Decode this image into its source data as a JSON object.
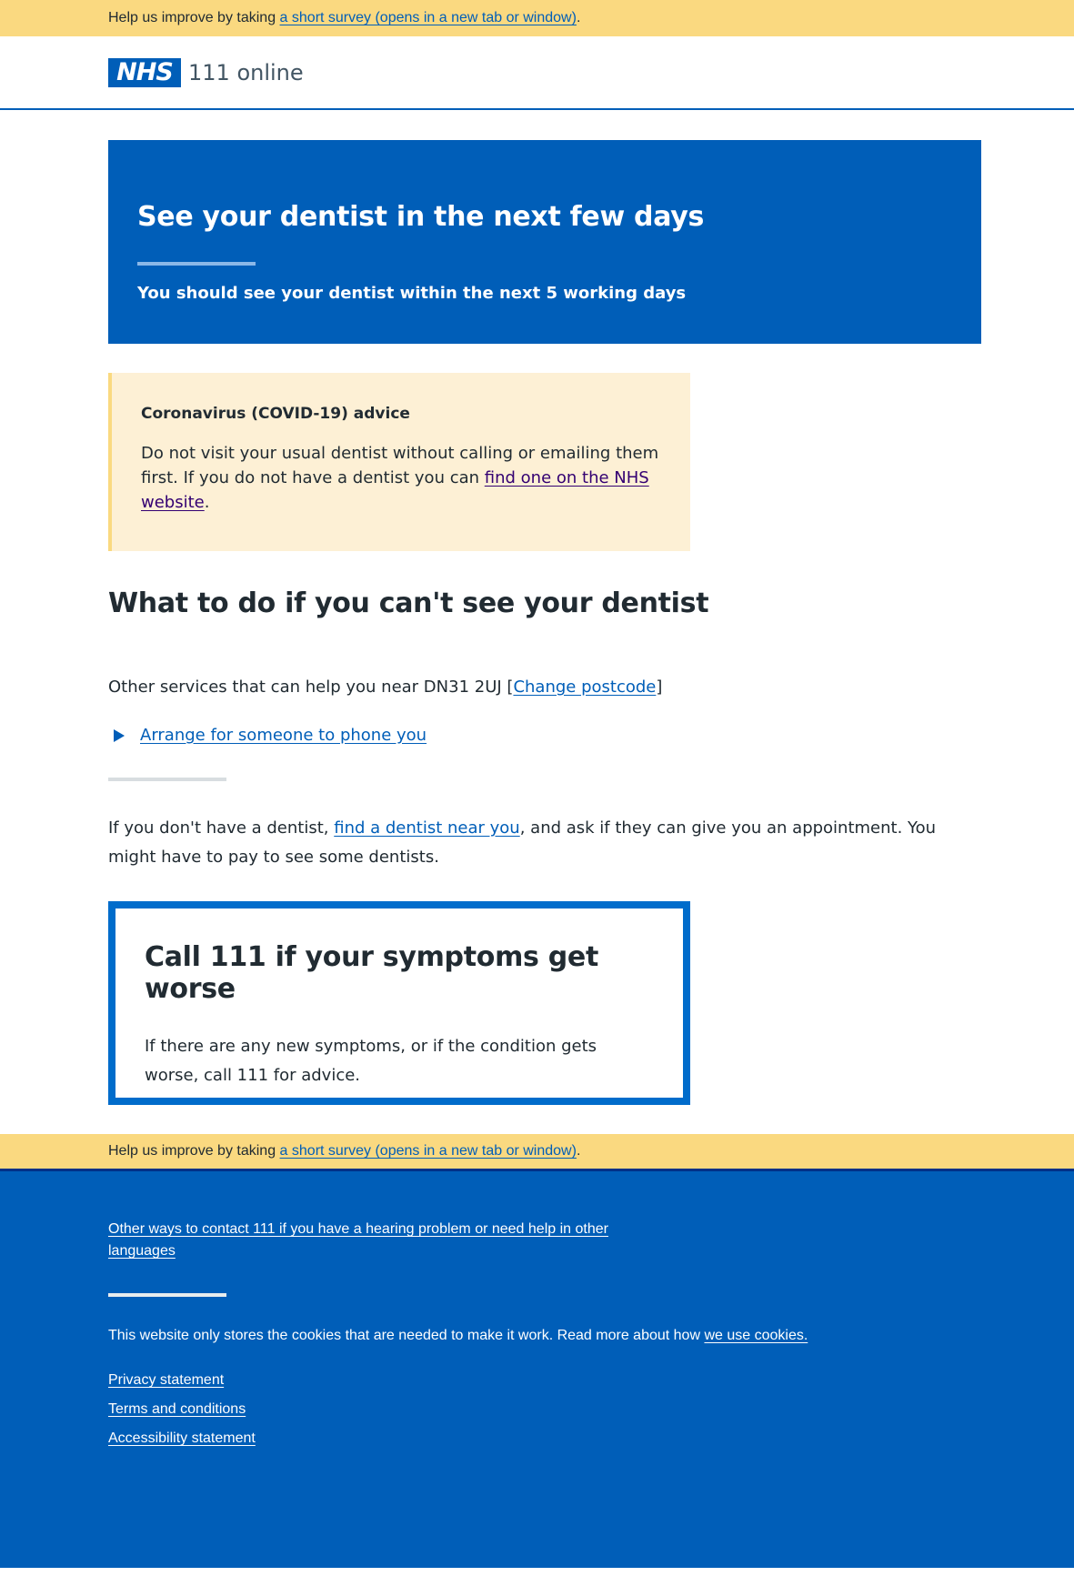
{
  "survey_banner": {
    "text": "Help us improve by taking ",
    "link": "a short survey (opens in a new tab or window)",
    "suffix": "."
  },
  "header": {
    "logo": "NHS",
    "service_name": "111 online"
  },
  "hero": {
    "title": "See your dentist in the next few days",
    "subtitle": "You should see your dentist within the next 5 working days"
  },
  "covid_warning": {
    "heading": "Coronavirus (COVID-19) advice",
    "text": "Do not visit your usual dentist without calling or emailing them first. If you do not have a dentist you can ",
    "link": "find one on the NHS website",
    "suffix": "."
  },
  "alternatives": {
    "title": "What to do if you can't see your dentist",
    "services_text": "Other services that can help you near DN31 2UJ [",
    "change_postcode_link": "Change postcode",
    "services_suffix": "]",
    "phone_link": "Arrange for someone to phone you"
  },
  "dentist_info": {
    "text_before": "If you don't have a dentist, ",
    "link": "find a dentist near you",
    "text_after": ", and ask if they can give you an appointment. You might have to pay to see some dentists."
  },
  "care_card": {
    "title": "Call 111 if your symptoms get worse",
    "text": "If there are any new symptoms, or if the condition gets worse, call 111 for advice."
  },
  "footer": {
    "contact_link": "Other ways to contact 111 if you have a hearing problem or need help in other languages",
    "cookie_text": "This website only stores the cookies that are needed to make it work. Read more about how ",
    "cookie_link": "we use cookies.",
    "links": [
      "Privacy statement",
      "Terms and conditions",
      "Accessibility statement"
    ]
  },
  "colors": {
    "nhs_blue": "#005eb8",
    "survey_yellow": "#fad980",
    "warning_bg": "#fdf0d5",
    "care_card_border": "#006ccb"
  }
}
